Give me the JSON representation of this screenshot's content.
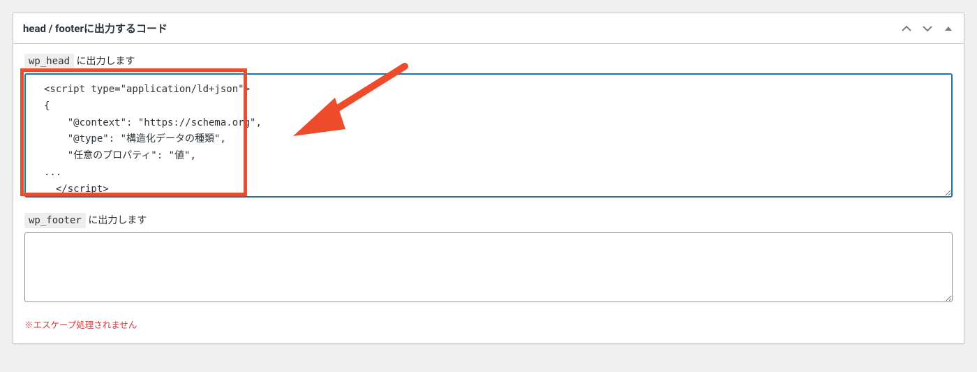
{
  "panel": {
    "title": "head / footerに出力するコード"
  },
  "head_section": {
    "tag": "wp_head",
    "label_suffix": " に出力します",
    "textarea_value": "<script type=\"application/ld+json\">\n{\n    \"@context\": \"https://schema.org\",\n    \"@type\": \"構造化データの種類\",\n    \"任意のプロパティ\": \"値\",\n...\n  </script>"
  },
  "footer_section": {
    "tag": "wp_footer",
    "label_suffix": " に出力します",
    "textarea_value": ""
  },
  "note_text": "※エスケープ処理されません",
  "colors": {
    "highlight": "#ee4b2b",
    "focus_border": "#2271b1",
    "note": "#d63638"
  }
}
